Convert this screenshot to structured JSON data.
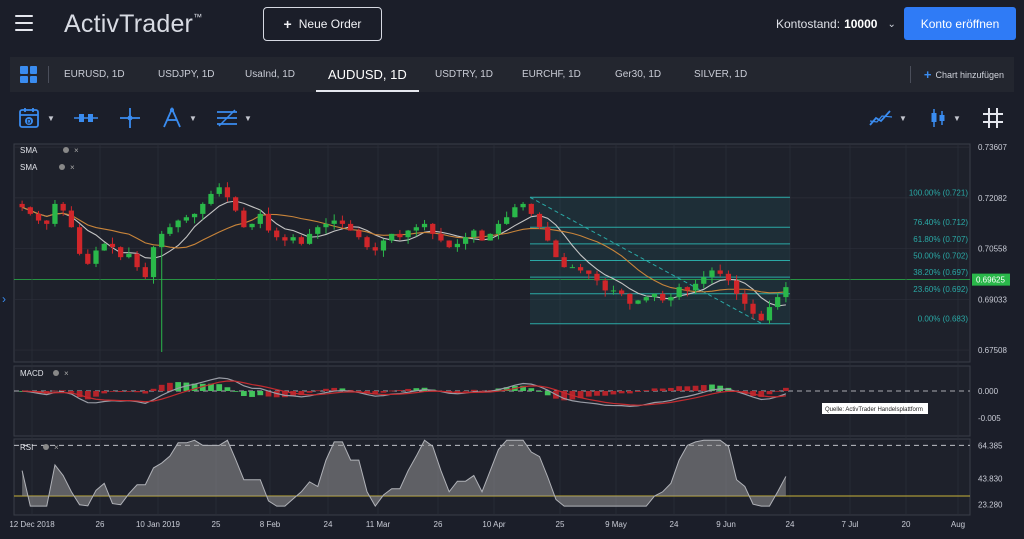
{
  "header": {
    "logo": "ActivTrader",
    "logo_tm": "™",
    "new_order_label": "Neue Order",
    "balance_label": "Kontostand:",
    "balance_value": "10000",
    "open_account_label": "Konto eröffnen"
  },
  "tabs": [
    {
      "label": "EURUSD, 1D",
      "active": false
    },
    {
      "label": "USDJPY, 1D",
      "active": false
    },
    {
      "label": "UsaInd, 1D",
      "active": false
    },
    {
      "label": "AUDUSD, 1D",
      "active": true
    },
    {
      "label": "USDTRY, 1D",
      "active": false
    },
    {
      "label": "EURCHF, 1D",
      "active": false
    },
    {
      "label": "Ger30, 1D",
      "active": false
    },
    {
      "label": "SILVER, 1D",
      "active": false
    }
  ],
  "add_chart_label": "Chart hinzufügen",
  "toolbar": {
    "icons": [
      "calendar-icon",
      "indicator-icon",
      "crosshair-icon",
      "drawing-icon",
      "lines-icon",
      "chart-type-icon",
      "candlestick-icon",
      "grid-toggle-icon"
    ]
  },
  "colors": {
    "accent": "#2f7bf6",
    "bg": "#1b1e29",
    "up": "#2ab84a",
    "down": "#d0262a",
    "fib": "#2aa9a6",
    "sma_slow": "#c8843a",
    "sma_fast": "#c4c4c4",
    "price_line": "#2ab84a"
  },
  "main_panel": {
    "indicator_labels": [
      "SMA",
      "SMA"
    ],
    "y_ticks": [
      "0.73607",
      "0.72082",
      "0.70558",
      "0.69033",
      "0.67508"
    ],
    "current_price": "0.69625",
    "fib_levels": [
      {
        "label": "100.00% (0.721)",
        "value": 0.721
      },
      {
        "label": "76.40% (0.712)",
        "value": 0.712
      },
      {
        "label": "61.80% (0.707)",
        "value": 0.707
      },
      {
        "label": "50.00% (0.702)",
        "value": 0.702
      },
      {
        "label": "38.20% (0.697)",
        "value": 0.697
      },
      {
        "label": "23.60% (0.692)",
        "value": 0.692
      },
      {
        "label": "0.00% (0.683)",
        "value": 0.683
      }
    ]
  },
  "macd_panel": {
    "label": "MACD",
    "y_ticks": [
      "0.000",
      "-0.005"
    ],
    "source_note": "Quelle: ActivTrader Handelsplattform"
  },
  "rsi_panel": {
    "label": "RSI",
    "y_ticks": [
      "64.385",
      "43.830",
      "23.280"
    ]
  },
  "x_axis": [
    "12 Dec 2018",
    "26",
    "10 Jan 2019",
    "25",
    "8 Feb",
    "24",
    "11 Mar",
    "26",
    "10 Apr",
    "25",
    "9 May",
    "24",
    "9 Jun",
    "24",
    "7 Jul",
    "20",
    "Aug"
  ],
  "chart_data": {
    "type": "candlestick",
    "symbol": "AUDUSD",
    "timeframe": "1D",
    "ylim": [
      0.6715,
      0.737
    ],
    "candles_approx_closes": [
      0.718,
      0.716,
      0.714,
      0.713,
      0.719,
      0.717,
      0.712,
      0.704,
      0.701,
      0.705,
      0.707,
      0.706,
      0.703,
      0.704,
      0.7,
      0.697,
      0.706,
      0.71,
      0.712,
      0.714,
      0.715,
      0.716,
      0.719,
      0.722,
      0.724,
      0.721,
      0.717,
      0.712,
      0.713,
      0.716,
      0.711,
      0.709,
      0.708,
      0.709,
      0.707,
      0.71,
      0.712,
      0.713,
      0.714,
      0.713,
      0.711,
      0.709,
      0.706,
      0.705,
      0.708,
      0.71,
      0.709,
      0.711,
      0.712,
      0.713,
      0.71,
      0.708,
      0.706,
      0.707,
      0.709,
      0.711,
      0.708,
      0.71,
      0.713,
      0.715,
      0.718,
      0.719,
      0.716,
      0.712,
      0.708,
      0.703,
      0.7,
      0.7,
      0.699,
      0.698,
      0.696,
      0.693,
      0.693,
      0.692,
      0.689,
      0.69,
      0.691,
      0.692,
      0.69,
      0.691,
      0.694,
      0.693,
      0.695,
      0.697,
      0.699,
      0.698,
      0.696,
      0.692,
      0.689,
      0.686,
      0.684,
      0.688,
      0.691,
      0.694
    ]
  }
}
